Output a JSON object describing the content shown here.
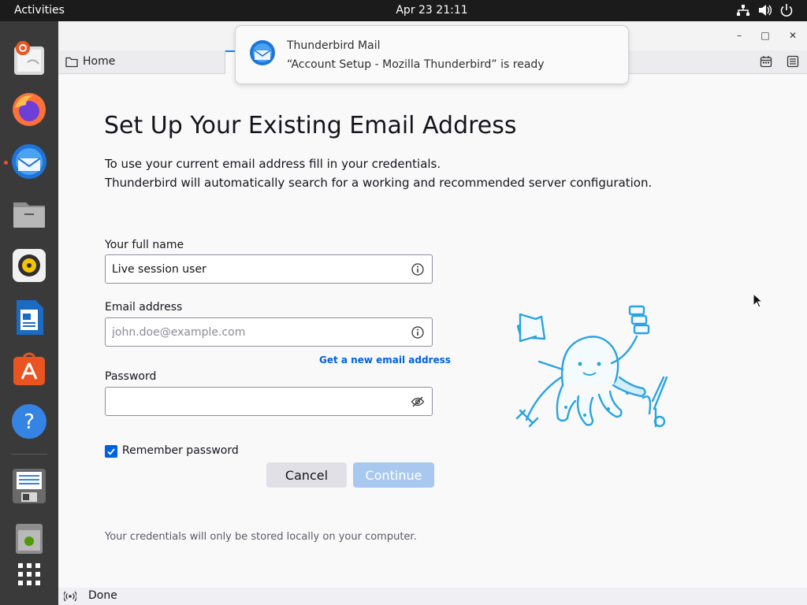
{
  "topbar": {
    "activities": "Activities",
    "clock": "Apr 23  21:11"
  },
  "dock": {
    "items": [
      "Ubuntu Installer",
      "Firefox",
      "Thunderbird",
      "Files",
      "Rhythmbox",
      "LibreOffice Writer",
      "Ubuntu Software",
      "Help",
      "Install Release",
      "Trash",
      "Show Applications"
    ]
  },
  "window": {
    "tab_home": "Home"
  },
  "notification": {
    "title": "Thunderbird Mail",
    "body": "“Account Setup - Mozilla Thunderbird” is ready"
  },
  "form": {
    "title": "Set Up Your Existing Email Address",
    "desc1": "To use your current email address fill in your credentials.",
    "desc2": "Thunderbird will automatically search for a working and recommended server configuration.",
    "name_label": "Your full name",
    "name_value": "Live session user",
    "email_label": "Email address",
    "email_placeholder": "john.doe@example.com",
    "new_email_link": "Get a new email address",
    "password_label": "Password",
    "remember_label": "Remember password",
    "remember_checked": true,
    "cancel": "Cancel",
    "continue": "Continue",
    "footnote": "Your credentials will only be stored locally on your computer."
  },
  "status": {
    "text": "Done"
  },
  "colors": {
    "accent": "#0061e0",
    "continue_disabled": "#a9c8ef",
    "ubuntu_orange": "#e95420"
  },
  "icons": [
    "network-icon",
    "volume-icon",
    "power-icon",
    "folder-icon",
    "calendar-icon",
    "tasks-icon",
    "info-icon",
    "eye-slash-icon",
    "checkmark-icon",
    "broadcast-icon"
  ]
}
